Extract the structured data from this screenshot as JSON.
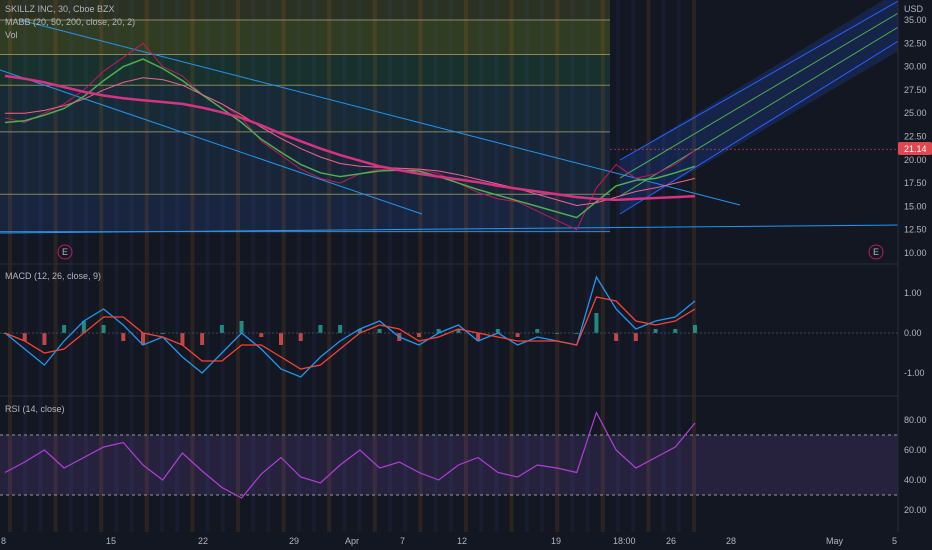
{
  "header": {
    "main_title": "SKILLZ INC, 30, Cboe BZX",
    "indicator_1": "MABB (20, 50, 200, close, 20, 2)",
    "indicator_2": "Vol",
    "currency": "USD",
    "macd_title": "MACD (12, 26, close, 9)",
    "rsi_title": "RSI (14, close)"
  },
  "price_badge": {
    "value": "21.14",
    "color": "#e0474f"
  },
  "earnings_markers": [
    "E",
    "E"
  ],
  "colors": {
    "background": "#131722",
    "ma_fast": "#f06292",
    "ma_mid": "#4caf50",
    "ma_slow": "#d63384",
    "macd_line": "#2196f3",
    "signal_line": "#f44336",
    "rsi_line": "#b03fd6",
    "rsi_band": "#3a1f4a",
    "channel": "#2962ff"
  },
  "chart_data": [
    {
      "type": "line",
      "name": "price",
      "y_axis_ticks": [
        "35.00",
        "32.50",
        "30.00",
        "27.50",
        "25.00",
        "22.50",
        "20.00",
        "17.50",
        "15.00",
        "12.50",
        "10.00"
      ],
      "ylim": [
        10,
        35
      ],
      "horizontal_levels": [
        35,
        31.3,
        28,
        23,
        16.3,
        12.3
      ],
      "series": [
        {
          "label": "price",
          "values": [
            24.5,
            24.0,
            25.0,
            26.0,
            27.5,
            29.5,
            31.0,
            32.5,
            30.0,
            29.0,
            27.0,
            26.0,
            24.5,
            22.0,
            20.5,
            19.0,
            18.0,
            17.5,
            18.5,
            19.0,
            18.8,
            19.0,
            18.5,
            17.5,
            16.5,
            15.8,
            15.5,
            14.5,
            13.5,
            12.5,
            17.0,
            19.5,
            18.0,
            18.5,
            19.5,
            21.0
          ]
        },
        {
          "label": "ma20",
          "values": [
            24.0,
            24.2,
            24.8,
            25.5,
            26.8,
            28.5,
            30.0,
            30.8,
            29.8,
            28.5,
            27.0,
            25.5,
            24.0,
            22.2,
            20.8,
            19.5,
            18.6,
            18.2,
            18.5,
            18.8,
            18.9,
            18.8,
            18.2,
            17.5,
            16.8,
            16.2,
            15.6,
            15.0,
            14.4,
            13.8,
            15.5,
            17.2,
            17.8,
            18.0,
            18.6,
            19.3
          ]
        },
        {
          "label": "ma50",
          "values": [
            25.0,
            25.0,
            25.3,
            25.8,
            26.5,
            27.5,
            28.3,
            28.8,
            28.6,
            28.0,
            27.0,
            26.0,
            24.8,
            23.5,
            22.3,
            21.2,
            20.3,
            19.6,
            19.3,
            19.2,
            19.1,
            19.0,
            18.8,
            18.4,
            17.9,
            17.4,
            16.9,
            16.3,
            15.7,
            15.1,
            15.4,
            16.0,
            16.6,
            17.0,
            17.5,
            18.0
          ]
        },
        {
          "label": "ma200",
          "values": [
            29.0,
            28.7,
            28.3,
            27.8,
            27.3,
            26.9,
            26.6,
            26.4,
            26.2,
            26.0,
            25.6,
            25.1,
            24.5,
            23.7,
            22.8,
            22.0,
            21.2,
            20.5,
            19.9,
            19.3,
            18.9,
            18.5,
            18.2,
            17.9,
            17.6,
            17.2,
            16.9,
            16.6,
            16.3,
            16.0,
            15.8,
            15.7,
            15.8,
            15.9,
            16.0,
            16.1
          ]
        }
      ]
    },
    {
      "type": "line",
      "name": "macd",
      "y_axis_ticks": [
        "1.00",
        "0.00",
        "-1.00"
      ],
      "ylim": [
        -1.5,
        1.5
      ],
      "series": [
        {
          "label": "macd",
          "values": [
            0.0,
            -0.4,
            -0.8,
            -0.2,
            0.3,
            0.6,
            0.2,
            -0.3,
            -0.1,
            -0.6,
            -1.0,
            -0.5,
            0.0,
            -0.4,
            -0.9,
            -1.1,
            -0.6,
            -0.2,
            0.1,
            0.3,
            -0.1,
            -0.3,
            0.0,
            0.2,
            -0.2,
            0.0,
            -0.3,
            -0.1,
            -0.2,
            -0.3,
            1.4,
            0.6,
            0.1,
            0.3,
            0.4,
            0.8
          ]
        },
        {
          "label": "signal",
          "values": [
            0.0,
            -0.2,
            -0.5,
            -0.4,
            0.0,
            0.4,
            0.4,
            0.0,
            -0.1,
            -0.3,
            -0.7,
            -0.7,
            -0.3,
            -0.3,
            -0.6,
            -0.9,
            -0.8,
            -0.4,
            0.0,
            0.2,
            0.1,
            -0.2,
            -0.1,
            0.1,
            0.0,
            -0.1,
            -0.2,
            -0.2,
            -0.2,
            -0.3,
            0.9,
            0.8,
            0.3,
            0.2,
            0.3,
            0.6
          ]
        }
      ],
      "histogram": [
        0.0,
        -0.2,
        -0.3,
        0.2,
        0.3,
        0.2,
        -0.2,
        -0.3,
        0.0,
        -0.3,
        -0.3,
        0.2,
        0.3,
        -0.1,
        -0.3,
        -0.2,
        0.2,
        0.2,
        0.1,
        0.1,
        -0.2,
        -0.1,
        0.1,
        0.1,
        -0.2,
        0.1,
        -0.1,
        0.1,
        0.0,
        0.0,
        0.5,
        -0.2,
        -0.2,
        0.1,
        0.1,
        0.2
      ]
    },
    {
      "type": "line",
      "name": "rsi",
      "y_axis_ticks": [
        "80.00",
        "60.00",
        "40.00",
        "20.00"
      ],
      "ylim": [
        10,
        90
      ],
      "band": [
        30,
        70
      ],
      "series": [
        {
          "label": "rsi",
          "values": [
            45,
            52,
            60,
            48,
            55,
            62,
            65,
            50,
            40,
            58,
            46,
            35,
            28,
            44,
            55,
            42,
            38,
            50,
            60,
            48,
            52,
            45,
            40,
            50,
            55,
            45,
            42,
            50,
            48,
            45,
            85,
            60,
            48,
            55,
            62,
            78
          ]
        }
      ]
    }
  ],
  "x_axis_ticks": [
    "8",
    "15",
    "22",
    "29",
    "Apr",
    "7",
    "12",
    "19",
    "18:00",
    "26",
    "28",
    "May",
    "5"
  ]
}
